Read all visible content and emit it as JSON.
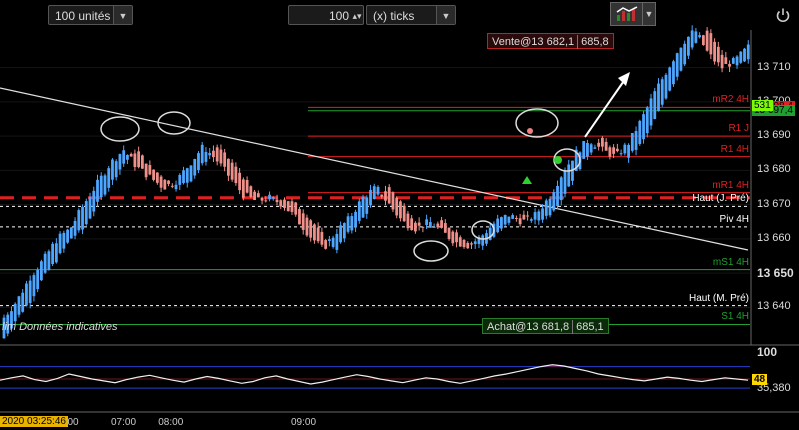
{
  "toolbar": {
    "units_value": "100 unités",
    "ticks_value": "100",
    "ticks_unit": "(x) ticks"
  },
  "orders": {
    "sell_label": "Vente@13 682,1",
    "sell_target": "685,8",
    "buy_label": "Achat@13 681,8",
    "buy_target": "685,1"
  },
  "footnote": "lim  Données indicatives",
  "time_badge": "2020 03:25:46",
  "colors": {
    "bull": "#4da6ff",
    "bear": "#f0908a",
    "resistance": "#e02020",
    "support": "#20a030",
    "trend": "#e0e0e0",
    "pivot": "#ffffff",
    "price_tag": "#7cfc00",
    "osc_tag": "#ffd700"
  },
  "chart_data": {
    "type": "candlestick",
    "y_axis": {
      "range": [
        13629,
        13721
      ],
      "ticks": [
        {
          "value": 13710,
          "label": "13 710"
        },
        {
          "value": 13700,
          "label": "13 700"
        },
        {
          "value": 13690,
          "label": "13 690"
        },
        {
          "value": 13680,
          "label": "13 680"
        },
        {
          "value": 13670,
          "label": "13 670"
        },
        {
          "value": 13660,
          "label": "13 660"
        },
        {
          "value": 13650,
          "label": "13 650",
          "bold": true
        },
        {
          "value": 13640,
          "label": "13 640"
        }
      ]
    },
    "x_axis": {
      "labels": [
        {
          "label": "00",
          "pos": 0.09
        },
        {
          "label": "07:00",
          "pos": 0.148
        },
        {
          "label": "08:00",
          "pos": 0.211
        },
        {
          "label": "09:00",
          "pos": 0.388
        }
      ]
    },
    "levels": [
      {
        "name": "mR2 4H",
        "label": "mR2 4H",
        "value": 13698.4,
        "price_label": "13 698,4",
        "color": "#e02020",
        "style": "solid"
      },
      {
        "name": "R2 4H",
        "label": "",
        "value": 13697.4,
        "price_label": "13 697,4",
        "color": "#20a030",
        "style": "solid"
      },
      {
        "name": "R1 J",
        "label": "R1 J",
        "value": 13690,
        "color": "#e02020",
        "style": "solid"
      },
      {
        "name": "R1 4H",
        "label": "R1 4H",
        "value": 13684,
        "color": "#e02020",
        "style": "solid"
      },
      {
        "name": "mR1 4H",
        "label": "mR1 4H",
        "value": 13673.5,
        "color": "#e02020",
        "style": "solid"
      },
      {
        "name": "Haut (J. Pré)",
        "label": "Haut (J. Pré)",
        "value": 13669.5,
        "color": "#ffffff",
        "style": "dashed"
      },
      {
        "name": "Piv 4H",
        "label": "Piv 4H",
        "value": 13663.5,
        "color": "#ffffff",
        "style": "dashed"
      },
      {
        "name": "mS1 4H",
        "label": "mS1 4H",
        "value": 13651,
        "color": "#20a030",
        "style": "solid"
      },
      {
        "name": "Haut (M. Pré)",
        "label": "Haut (M. Pré)",
        "value": 13640.5,
        "color": "#ffffff",
        "style": "dashed"
      },
      {
        "name": "S1 4H",
        "label": "S1 4H",
        "value": 13635,
        "color": "#20a030",
        "style": "solid"
      }
    ],
    "thick_level": {
      "value": 13672,
      "color": "#e02020",
      "style": "dashed"
    },
    "price_tag": {
      "value": 13700,
      "label": "531"
    },
    "ohlc_profile": [
      [
        13631,
        13628,
        13639,
        13637
      ],
      [
        13637,
        13634,
        13644,
        13642
      ],
      [
        13642,
        13638,
        13650,
        13649
      ],
      [
        13649,
        13646,
        13656,
        13654
      ],
      [
        13654,
        13651,
        13662,
        13660
      ],
      [
        13660,
        13657,
        13666,
        13663
      ],
      [
        13663,
        13660,
        13672,
        13670
      ],
      [
        13670,
        13667,
        13678,
        13676
      ],
      [
        13676,
        13673,
        13684,
        13682
      ],
      [
        13682,
        13679,
        13688,
        13686
      ],
      [
        13686,
        13680,
        13688,
        13681
      ],
      [
        13681,
        13677,
        13684,
        13678
      ],
      [
        13678,
        13673,
        13680,
        13675
      ],
      [
        13675,
        13672,
        13679,
        13677
      ],
      [
        13677,
        13675,
        13684,
        13682
      ],
      [
        13682,
        13679,
        13690,
        13687
      ],
      [
        13687,
        13681,
        13689,
        13683
      ],
      [
        13683,
        13676,
        13685,
        13678
      ],
      [
        13678,
        13671,
        13680,
        13673
      ],
      [
        13673,
        13669,
        13676,
        13671
      ],
      [
        13671,
        13668,
        13674,
        13672
      ],
      [
        13672,
        13668,
        13675,
        13670
      ],
      [
        13670,
        13665,
        13672,
        13666
      ],
      [
        13666,
        13659,
        13668,
        13661
      ],
      [
        13661,
        13655,
        13663,
        13657
      ],
      [
        13657,
        13655,
        13664,
        13662
      ],
      [
        13662,
        13660,
        13668,
        13666
      ],
      [
        13666,
        13664,
        13674,
        13672
      ],
      [
        13672,
        13670,
        13678,
        13675
      ],
      [
        13675,
        13668,
        13677,
        13670
      ],
      [
        13670,
        13663,
        13672,
        13665
      ],
      [
        13665,
        13661,
        13668,
        13663
      ],
      [
        13663,
        13660,
        13667,
        13665
      ],
      [
        13665,
        13661,
        13667,
        13662
      ],
      [
        13662,
        13658,
        13664,
        13659
      ],
      [
        13659,
        13656,
        13662,
        13658
      ],
      [
        13658,
        13656,
        13663,
        13661
      ],
      [
        13661,
        13659,
        13667,
        13665
      ],
      [
        13665,
        13663,
        13670,
        13667
      ],
      [
        13667,
        13664,
        13670,
        13665
      ],
      [
        13665,
        13662,
        13669,
        13667
      ],
      [
        13667,
        13665,
        13674,
        13672
      ],
      [
        13672,
        13670,
        13682,
        13679
      ],
      [
        13679,
        13677,
        13687,
        13685
      ],
      [
        13685,
        13682,
        13692,
        13689
      ],
      [
        13689,
        13685,
        13691,
        13686
      ],
      [
        13686,
        13682,
        13688,
        13684
      ],
      [
        13684,
        13681,
        13690,
        13688
      ],
      [
        13688,
        13686,
        13697,
        13695
      ],
      [
        13695,
        13693,
        13705,
        13703
      ],
      [
        13703,
        13701,
        13712,
        13710
      ],
      [
        13710,
        13708,
        13719,
        13717
      ],
      [
        13717,
        13715,
        13722,
        13721
      ],
      [
        13721,
        13712,
        13722,
        13714
      ],
      [
        13714,
        13708,
        13716,
        13710
      ],
      [
        13710,
        13707,
        13714,
        13712
      ],
      [
        13712,
        13710,
        13718,
        13716
      ]
    ],
    "oscillator": {
      "range": [
        0,
        100
      ],
      "label": "100",
      "upper_band": 70,
      "lower_band": 35.38,
      "lower_label": "35,380",
      "current": 48,
      "current_label": "48",
      "values": [
        48,
        52,
        55,
        49,
        46,
        51,
        58,
        54,
        50,
        47,
        44,
        49,
        53,
        56,
        52,
        48,
        45,
        50,
        54,
        51,
        47,
        43,
        46,
        52,
        55,
        50,
        46,
        42,
        45,
        49,
        53,
        57,
        54,
        50,
        47,
        44,
        48,
        52,
        50,
        46,
        43,
        47,
        51,
        55,
        58,
        62,
        66,
        70,
        73,
        71,
        67,
        63,
        58,
        55,
        52,
        49,
        47,
        50,
        53,
        51,
        48,
        46,
        49,
        52,
        50,
        48
      ]
    }
  }
}
